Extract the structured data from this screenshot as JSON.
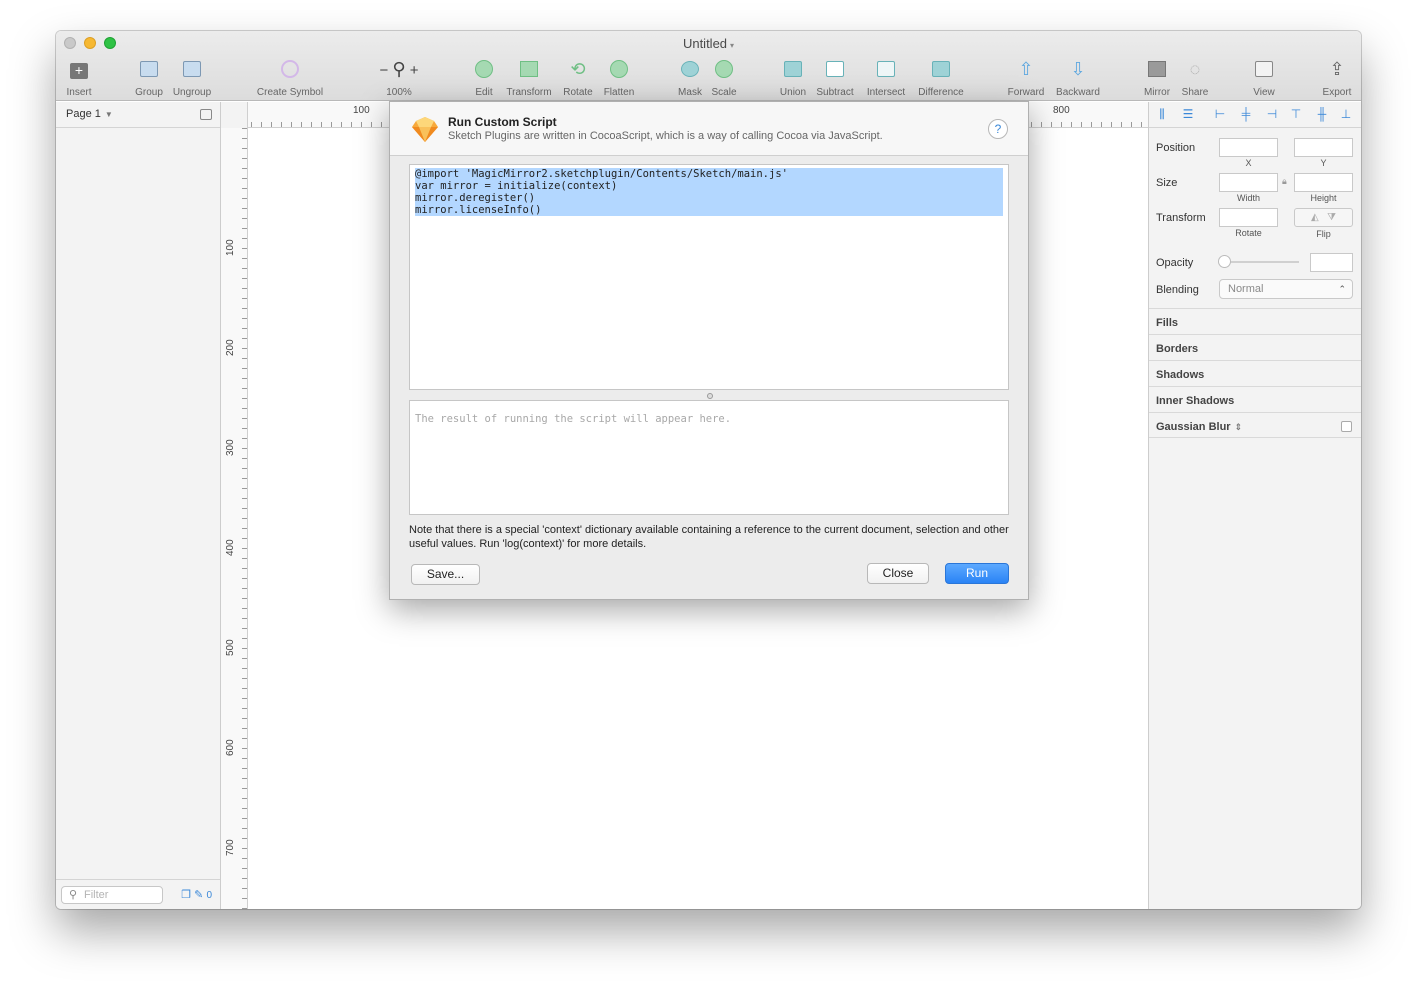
{
  "window": {
    "title": "Untitled",
    "accent": "#2a83f5"
  },
  "toolbar": {
    "items": [
      {
        "label": "Insert",
        "icon": "insert-icon"
      },
      {
        "label": "Group",
        "icon": "group-icon"
      },
      {
        "label": "Ungroup",
        "icon": "ungroup-icon"
      },
      {
        "label": "Create Symbol",
        "icon": "symbol-icon"
      },
      {
        "label": "100%",
        "icon": "zoom-icon"
      },
      {
        "label": "Edit",
        "icon": "edit-icon"
      },
      {
        "label": "Transform",
        "icon": "transform-icon"
      },
      {
        "label": "Rotate",
        "icon": "rotate-icon"
      },
      {
        "label": "Flatten",
        "icon": "flatten-icon"
      },
      {
        "label": "Mask",
        "icon": "mask-icon"
      },
      {
        "label": "Scale",
        "icon": "scale-icon"
      },
      {
        "label": "Union",
        "icon": "union-icon"
      },
      {
        "label": "Subtract",
        "icon": "subtract-icon"
      },
      {
        "label": "Intersect",
        "icon": "intersect-icon"
      },
      {
        "label": "Difference",
        "icon": "difference-icon"
      },
      {
        "label": "Forward",
        "icon": "forward-icon"
      },
      {
        "label": "Backward",
        "icon": "backward-icon"
      },
      {
        "label": "Mirror",
        "icon": "mirror-icon"
      },
      {
        "label": "Share",
        "icon": "share-icon"
      },
      {
        "label": "View",
        "icon": "view-icon"
      },
      {
        "label": "Export",
        "icon": "export-icon"
      }
    ]
  },
  "sidebar": {
    "page_name": "Page 1",
    "filter_placeholder": "Filter",
    "filter_count": "0"
  },
  "rulers": {
    "top": [
      "100",
      "800"
    ],
    "left": [
      "100",
      "200",
      "300",
      "400",
      "500",
      "600",
      "700"
    ]
  },
  "inspector": {
    "position_label": "Position",
    "x_label": "X",
    "y_label": "Y",
    "size_label": "Size",
    "width_label": "Width",
    "height_label": "Height",
    "transform_label": "Transform",
    "rotate_label": "Rotate",
    "flip_label": "Flip",
    "opacity_label": "Opacity",
    "blending_label": "Blending",
    "blending_value": "Normal",
    "sections": [
      "Fills",
      "Borders",
      "Shadows",
      "Inner Shadows",
      "Gaussian Blur"
    ]
  },
  "dialog": {
    "title": "Run Custom Script",
    "subtitle": "Sketch Plugins are written in CocoaScript, which is a way of calling Cocoa via JavaScript.",
    "help": "?",
    "code_lines": [
      "@import 'MagicMirror2.sketchplugin/Contents/Sketch/main.js'",
      "var mirror = initialize(context)",
      "mirror.deregister()",
      "mirror.licenseInfo()"
    ],
    "result_placeholder": "The result of running the script will appear here.",
    "note": "Note that there is a special 'context' dictionary available containing a reference to the current document, selection and other useful values. Run 'log(context)' for more details.",
    "save_label": "Save...",
    "close_label": "Close",
    "run_label": "Run"
  }
}
